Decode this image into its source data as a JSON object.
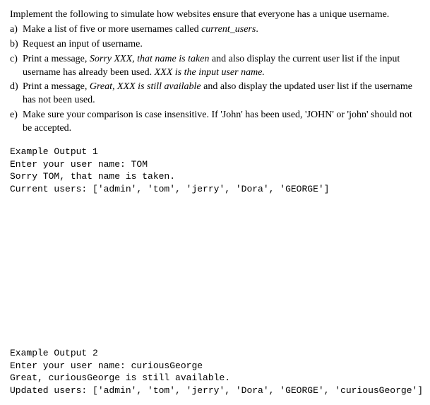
{
  "intro": "Implement the following to simulate how websites ensure that everyone has a unique username.",
  "items": {
    "a": {
      "marker": "a)",
      "pre": "Make a list of five or more usernames called ",
      "em": "current_users",
      "post": "."
    },
    "b": {
      "marker": "b)",
      "text": "Request an input of username."
    },
    "c": {
      "marker": "c)",
      "pre": "Print a message, ",
      "em1": "Sorry XXX, that name is taken",
      "mid": " and also display the current user list if the input username has already been used.  ",
      "em2": "XXX is the input user name."
    },
    "d": {
      "marker": "d)",
      "pre": "Print a message, ",
      "em": "Great, XXX is still available",
      "post": " and also display the updated user list if the username has not been used."
    },
    "e": {
      "marker": "e)",
      "text": "Make sure your comparison is case insensitive. If 'John' has been used, 'JOHN' or 'john' should not be accepted."
    }
  },
  "example1": {
    "title": "Example Output 1",
    "line1": "Enter your user name: TOM",
    "line2": "Sorry TOM, that name is taken.",
    "line3": "Current users: ['admin', 'tom', 'jerry', 'Dora', 'GEORGE']"
  },
  "example2": {
    "title": "Example Output 2",
    "line1": "Enter your user name: curiousGeorge",
    "line2": "Great, curiousGeorge is still available.",
    "line3": "Updated users: ['admin', 'tom', 'jerry', 'Dora', 'GEORGE', 'curiousGeorge']"
  }
}
